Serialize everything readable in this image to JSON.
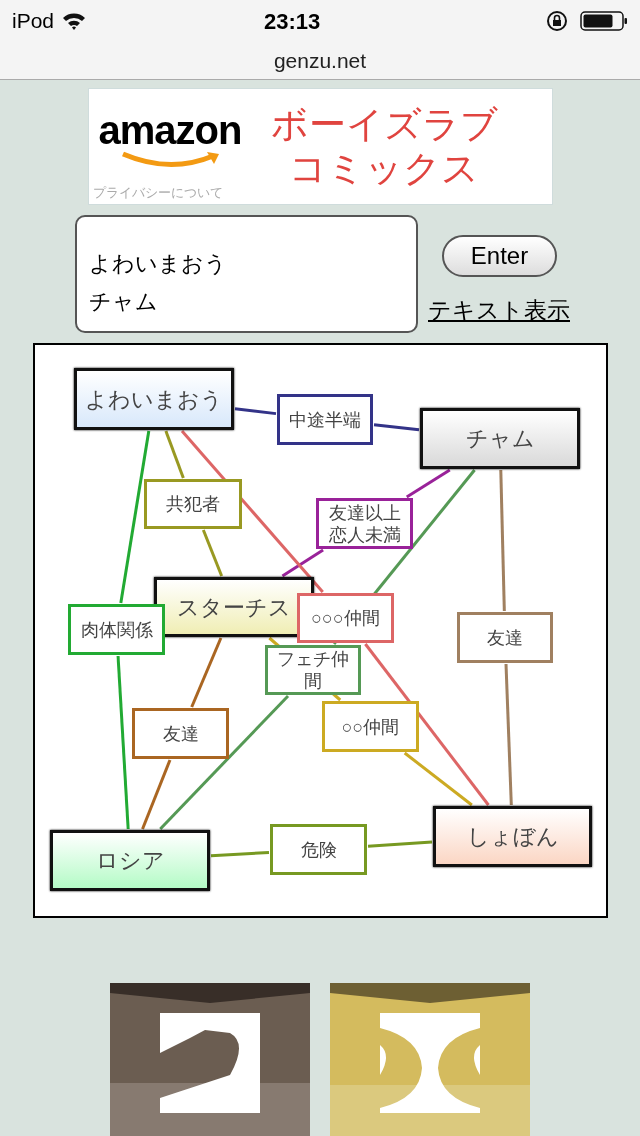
{
  "status_bar": {
    "carrier": "iPod",
    "time": "23:13"
  },
  "url": "genzu.net",
  "ad": {
    "logo": "amazon",
    "privacy": "プライバシーについて",
    "headline": "ボーイズラブコミックス"
  },
  "input": {
    "lines": [
      "よわいまおう",
      "チャム"
    ]
  },
  "enter_button": "Enter",
  "text_link": "テキスト表示",
  "diagram": {
    "nodes": [
      {
        "name": "よわいまおう",
        "color": "#d8e8fb"
      },
      {
        "name": "チャム",
        "color": "#d9d9d9"
      },
      {
        "name": "スターチス",
        "color": "#f0eeb4"
      },
      {
        "name": "ロシア",
        "color": "#b4fbc6"
      },
      {
        "name": "しょぼん",
        "color": "#fbd6c4"
      }
    ],
    "relations": [
      {
        "label": "中途半端",
        "color": "#333388"
      },
      {
        "label": "共犯者",
        "color": "#999922"
      },
      {
        "label": "友達以上恋人未満",
        "color": "#992299"
      },
      {
        "label": "○○○仲間",
        "color": "#dd6666"
      },
      {
        "label": "肉体関係",
        "color": "#22aa33"
      },
      {
        "label": "友達",
        "color": "#a08060"
      },
      {
        "label": "フェチ仲間",
        "color": "#559955"
      },
      {
        "label": "○○仲間",
        "color": "#ccaa22"
      },
      {
        "label": "友達",
        "color": "#aa6622"
      },
      {
        "label": "危険",
        "color": "#779922"
      }
    ]
  }
}
